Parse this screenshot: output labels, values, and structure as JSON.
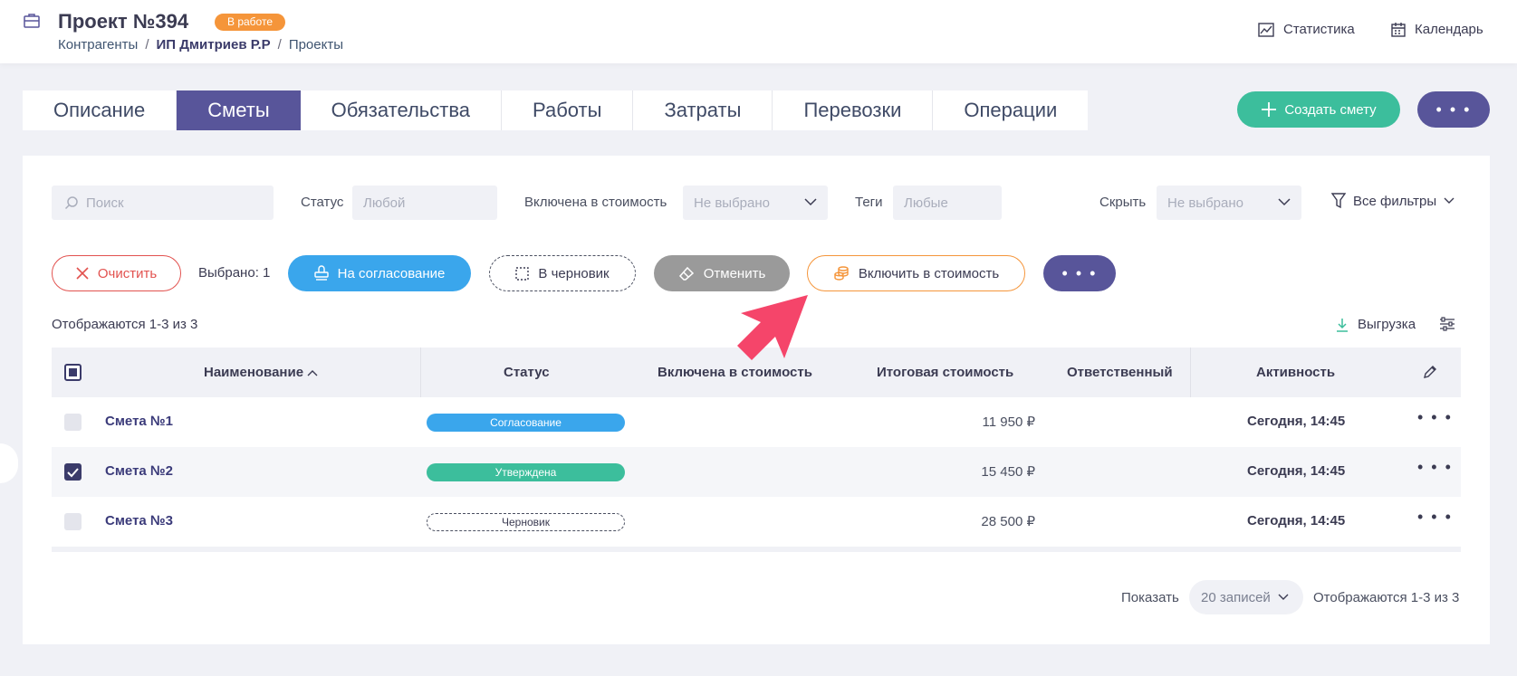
{
  "header": {
    "title": "Проект №394",
    "status_badge": "В работе",
    "breadcrumbs": [
      "Контрагенты",
      "ИП Дмитриев Р.Р",
      "Проекты"
    ],
    "stats_label": "Статистика",
    "calendar_label": "Календарь"
  },
  "tabs": [
    {
      "label": "Описание",
      "active": false
    },
    {
      "label": "Сметы",
      "active": true
    },
    {
      "label": "Обязательства",
      "active": false
    },
    {
      "label": "Работы",
      "active": false
    },
    {
      "label": "Затраты",
      "active": false
    },
    {
      "label": "Перевозки",
      "active": false
    },
    {
      "label": "Операции",
      "active": false
    }
  ],
  "actions": {
    "create_label": "Создать смету",
    "more_label": "• • •"
  },
  "filters": {
    "search_placeholder": "Поиск",
    "status_label": "Статус",
    "status_value": "Любой",
    "included_label": "Включена в стоимость",
    "included_value": "Не выбрано",
    "tags_label": "Теги",
    "tags_value": "Любые",
    "hide_label": "Скрыть",
    "hide_value": "Не выбрано",
    "all_filters_label": "Все фильтры"
  },
  "bulk": {
    "clear_label": "Очистить",
    "selected_text": "Выбрано: 1",
    "approve_label": "На согласование",
    "draft_label": "В черновик",
    "cancel_label": "Отменить",
    "include_label": "Включить в стоимость",
    "more_label": "• • •"
  },
  "list_info": {
    "shown_text": "Отображаются 1-3 из 3",
    "export_label": "Выгрузка"
  },
  "table": {
    "columns": {
      "name": "Наименование",
      "status": "Статус",
      "included": "Включена в стоимость",
      "total": "Итоговая стоимость",
      "responsible": "Ответственный",
      "activity": "Активность"
    },
    "rows": [
      {
        "name": "Смета №1",
        "status": "Согласование",
        "status_color": "#3aa6ec",
        "total": "11 950 ₽",
        "activity": "Сегодня, 14:45",
        "checked": false,
        "more": "• • •"
      },
      {
        "name": "Смета №2",
        "status": "Утверждена",
        "status_color": "#3cbe9c",
        "total": "15 450 ₽",
        "activity": "Сегодня, 14:45",
        "checked": true,
        "more": "• • •"
      },
      {
        "name": "Смета №3",
        "status": "Черновик",
        "status_color": "#ffffff",
        "total": "28 500 ₽",
        "activity": "Сегодня, 14:45",
        "checked": false,
        "more": "• • •"
      }
    ]
  },
  "pagination": {
    "show_label": "Показать",
    "per_page": "20 записей",
    "shown_text": "Отображаются 1-3 из 3"
  },
  "colors": {
    "accent_purple": "#58559a",
    "green": "#3cbe9c",
    "blue": "#3aa6ec",
    "orange": "#f5953a",
    "red": "#e2524f",
    "pointer_arrow": "#f5456a"
  }
}
